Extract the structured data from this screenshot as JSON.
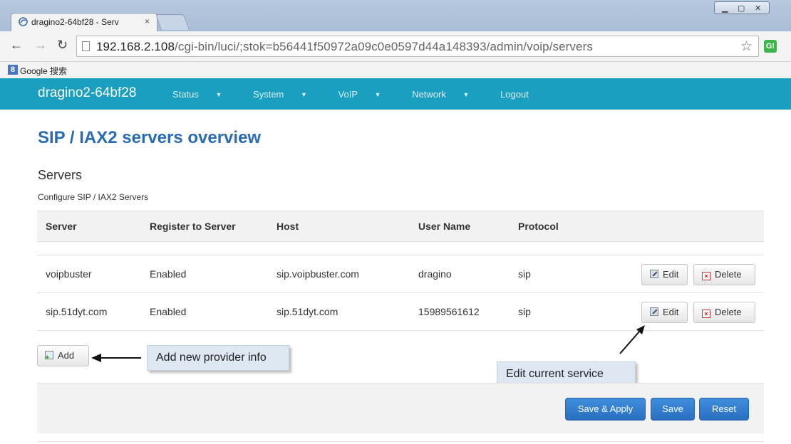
{
  "browser": {
    "tab_title": "dragino2-64bf28 - Serv",
    "tab_close": "×",
    "url_host": "192.168.2.108",
    "url_path": "/cgi-bin/luci/;stok=b56441f50972a09c0e0597d44a148393/admin/voip/servers",
    "bookmark_label": "Google 搜索",
    "bookmark_icon": "8",
    "ext_label": "G!"
  },
  "header": {
    "brand": "dragino2-64bf28",
    "menu": [
      {
        "label": "Status",
        "has_caret": true
      },
      {
        "label": "System",
        "has_caret": true
      },
      {
        "label": "VoIP",
        "has_caret": true
      },
      {
        "label": "Network",
        "has_caret": true
      },
      {
        "label": "Logout",
        "has_caret": false
      }
    ]
  },
  "page": {
    "title": "SIP / IAX2 servers overview",
    "section_title": "Servers",
    "section_desc": "Configure SIP / IAX2 Servers"
  },
  "table": {
    "headers": [
      "Server",
      "Register to Server",
      "Host",
      "User Name",
      "Protocol"
    ],
    "rows": [
      {
        "server": "voipbuster",
        "register": "Enabled",
        "host": "sip.voipbuster.com",
        "user": "dragino",
        "protocol": "sip"
      },
      {
        "server": "sip.51dyt.com",
        "register": "Enabled",
        "host": "sip.51dyt.com",
        "user": "15989561612",
        "protocol": "sip"
      }
    ],
    "edit_label": "Edit",
    "delete_label": "Delete"
  },
  "add_label": "Add",
  "annotations": {
    "add_callout": "Add  new provider info",
    "edit_callout": "Edit current service"
  },
  "actions": {
    "save_apply": "Save & Apply",
    "save": "Save",
    "reset": "Reset"
  },
  "colors": {
    "header_bg": "#1a9fc0",
    "title": "#2a6cb3",
    "primary_button": "#2a6ec0"
  }
}
